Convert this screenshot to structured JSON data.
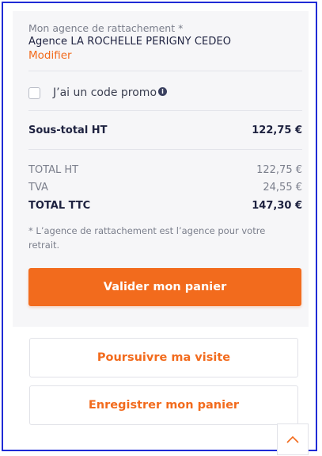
{
  "agency": {
    "label": "Mon agence de rattachement *",
    "name": "Agence LA ROCHELLE PERIGNY CEDEO",
    "modify_label": "Modifier"
  },
  "promo": {
    "label": "J’ai un code promo",
    "checked": false,
    "info_icon": "info-icon"
  },
  "subtotal": {
    "label": "Sous-total HT",
    "value": "122,75 €"
  },
  "totals": {
    "ht_label": "TOTAL HT",
    "ht_value": "122,75 €",
    "tva_label": "TVA",
    "tva_value": "24,55 €",
    "ttc_label": "TOTAL TTC",
    "ttc_value": "147,30 €"
  },
  "note": "* L’agence de rattachement est l’agence pour votre retrait.",
  "actions": {
    "validate_label": "Valider mon panier",
    "continue_label": "Poursuivre ma visite",
    "save_label": "Enregistrer mon panier"
  },
  "scroll_top_icon": "chevron-up-icon",
  "colors": {
    "accent": "#f26b1d",
    "frame": "#1f2bd6",
    "text": "#1e2240",
    "muted": "#7b7f8c"
  }
}
